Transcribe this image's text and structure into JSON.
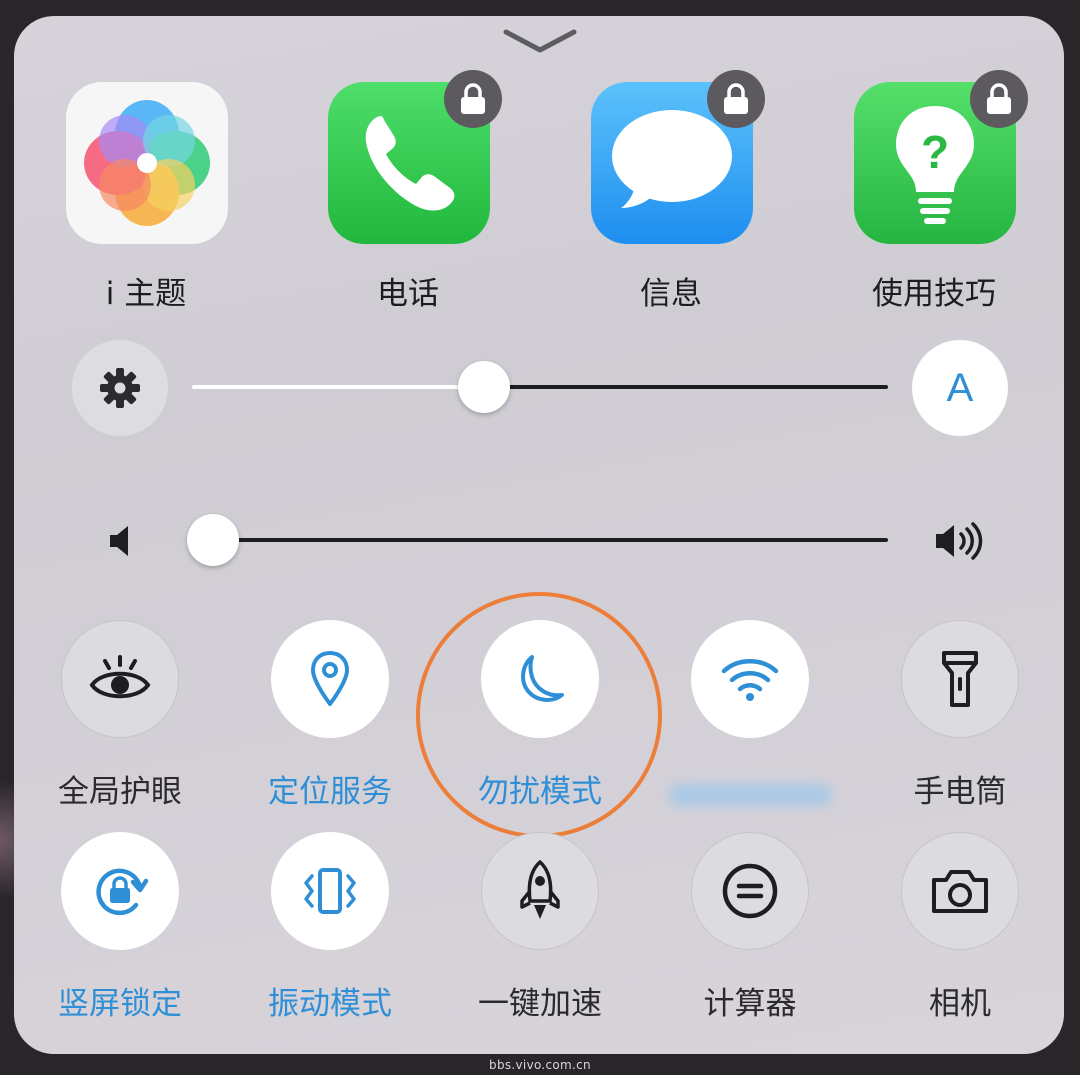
{
  "apps": [
    {
      "label": "i 主题",
      "icon": "theme-flower-icon",
      "locked": false
    },
    {
      "label": "电话",
      "icon": "phone-icon",
      "locked": true
    },
    {
      "label": "信息",
      "icon": "message-bubble-icon",
      "locked": true
    },
    {
      "label": "使用技巧",
      "icon": "lightbulb-question-icon",
      "locked": true
    }
  ],
  "brightness": {
    "settings_icon": "gear-icon",
    "auto_label": "A",
    "level": 0.42
  },
  "volume": {
    "low_icon": "speaker-low-icon",
    "high_icon": "speaker-high-icon",
    "level": 0.03
  },
  "toggles_row1": [
    {
      "label": "全局护眼",
      "icon": "eye-icon",
      "active": false
    },
    {
      "label": "定位服务",
      "icon": "location-pin-icon",
      "active": true
    },
    {
      "label": "勿扰模式",
      "icon": "moon-icon",
      "active": true
    },
    {
      "label": "",
      "icon": "wifi-icon",
      "active": true
    },
    {
      "label": "手电筒",
      "icon": "flashlight-icon",
      "active": false
    }
  ],
  "toggles_row2": [
    {
      "label": "竖屏锁定",
      "icon": "rotation-lock-icon",
      "active": true
    },
    {
      "label": "振动模式",
      "icon": "vibrate-icon",
      "active": true
    },
    {
      "label": "一键加速",
      "icon": "rocket-icon",
      "active": false
    },
    {
      "label": "计算器",
      "icon": "calculator-icon",
      "active": false
    },
    {
      "label": "相机",
      "icon": "camera-icon",
      "active": false
    }
  ],
  "highlighted_toggle": "勿扰模式",
  "colors": {
    "accent_blue": "#2f8fd6",
    "highlight_ring": "#ec7e3a",
    "lock_badge": "#5c5a5f"
  },
  "watermark": "bbs.vivo.com.cn"
}
